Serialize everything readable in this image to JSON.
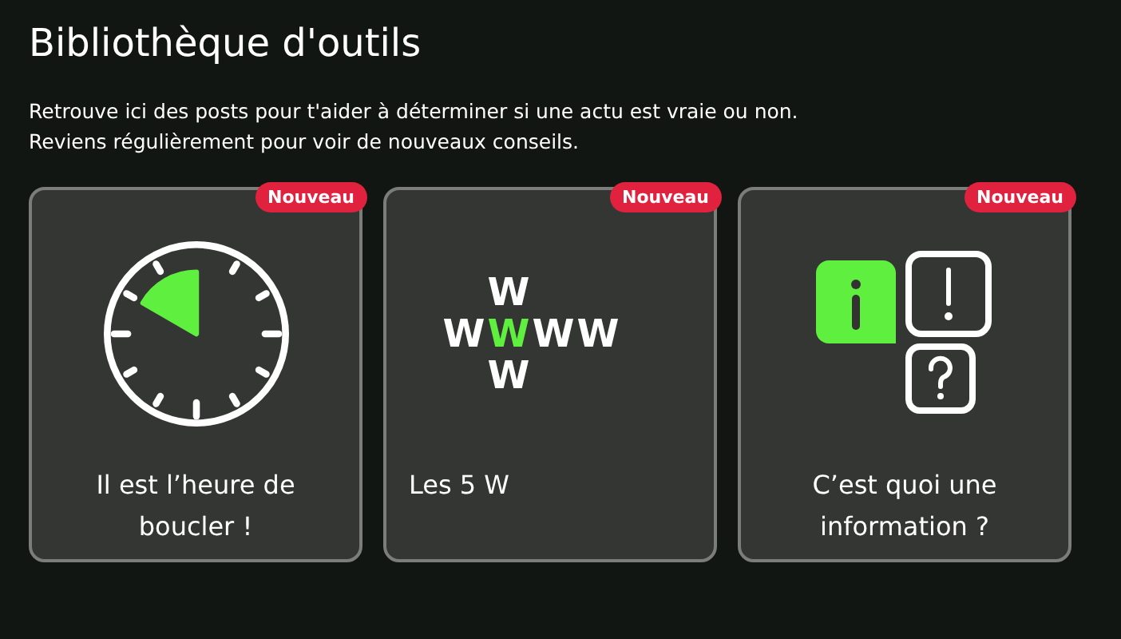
{
  "title": "Bibliothèque d'outils",
  "intro": [
    "Retrouve ici des posts pour t'aider à déterminer si une actu est vraie ou non.",
    "Reviens régulièrement pour voir de nouveaux conseils."
  ],
  "cards": [
    {
      "kind": "clock",
      "badge": "Nouveau",
      "title": "Il est l’heure de boucler !",
      "title_centered": true
    },
    {
      "kind": "letters",
      "badge": "Nouveau",
      "title": "Les 5 W",
      "title_centered": false,
      "letters": {
        "top": "W",
        "row": [
          {
            "text": "W",
            "highlighted": false
          },
          {
            "text": "W",
            "highlighted": true
          },
          {
            "text": "W",
            "highlighted": false
          },
          {
            "text": "W",
            "highlighted": false
          }
        ],
        "bottom": "W"
      }
    },
    {
      "kind": "info",
      "badge": "Nouveau",
      "title": "C’est quoi une information ?",
      "title_centered": true
    }
  ]
}
